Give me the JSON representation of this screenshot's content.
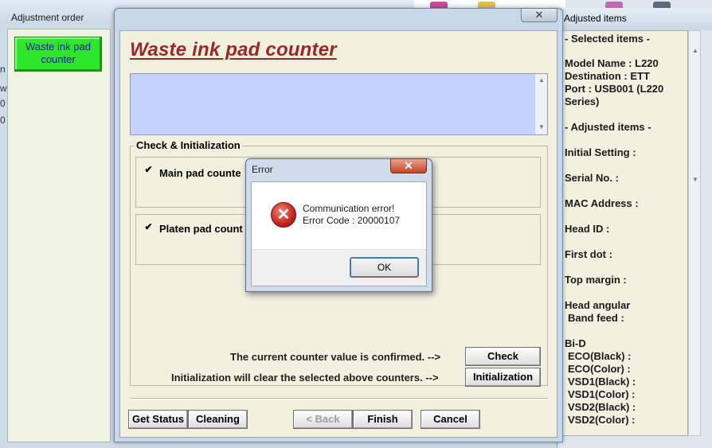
{
  "background_window": {
    "title": "Adjustment order",
    "waste_button_label": "Waste ink pad counter",
    "clipped_chars": [
      "n",
      "w",
      "0",
      "0"
    ]
  },
  "main_window": {
    "close_glyph": "✕",
    "title": "Waste ink pad counter",
    "group_label": "Check & Initialization",
    "main_pad_label": "Main pad counte",
    "platen_pad_label": "Platen pad count",
    "check_glyph": "✔",
    "confirm_statement": "The current counter value is confirmed. -->",
    "init_statement": "Initialization will clear the selected above counters. -->",
    "check_button": "Check",
    "init_button": "Initialization",
    "get_status_button": "Get Status",
    "cleaning_button": "Cleaning",
    "back_button": "< Back",
    "finish_button": "Finish",
    "cancel_button": "Cancel"
  },
  "right_panel": {
    "title": "Adjusted items",
    "selected_header": "- Selected items -",
    "model_name": "Model Name : L220",
    "destination": "Destination : ETT",
    "port_line1": "Port : USB001 (L220",
    "port_line2": "Series)",
    "adjusted_header": "- Adjusted items -",
    "initial_setting": "Initial Setting :",
    "serial_no": "Serial No. :",
    "mac_address": "MAC Address :",
    "head_id": "Head ID :",
    "first_dot": "First dot :",
    "top_margin": "Top margin :",
    "head_angular": "Head angular",
    "band_feed": "Band feed :",
    "bi_d": "Bi-D",
    "eco_black": "ECO(Black)  :",
    "eco_color": "ECO(Color)  :",
    "vsd1_black": "VSD1(Black) :",
    "vsd1_color": "VSD1(Color) :",
    "vsd2_black": "VSD2(Black) :",
    "vsd2_color": "VSD2(Color) :"
  },
  "error_dialog": {
    "title": "Error",
    "close_glyph": "✕",
    "icon_glyph": "✕",
    "message_line1": "Communication error!",
    "message_line2": "Error Code : 20000107",
    "ok_button": "OK"
  },
  "colors": {
    "title_red": "#a02626",
    "waste_button_green": "#2ee72a",
    "textbox_blue": "#c5d2fd",
    "panel_bg": "#f2f1e0"
  },
  "icons": [
    "error-icon",
    "close-icon",
    "checkbox-check-icon",
    "scroll-up-icon",
    "scroll-down-icon"
  ]
}
